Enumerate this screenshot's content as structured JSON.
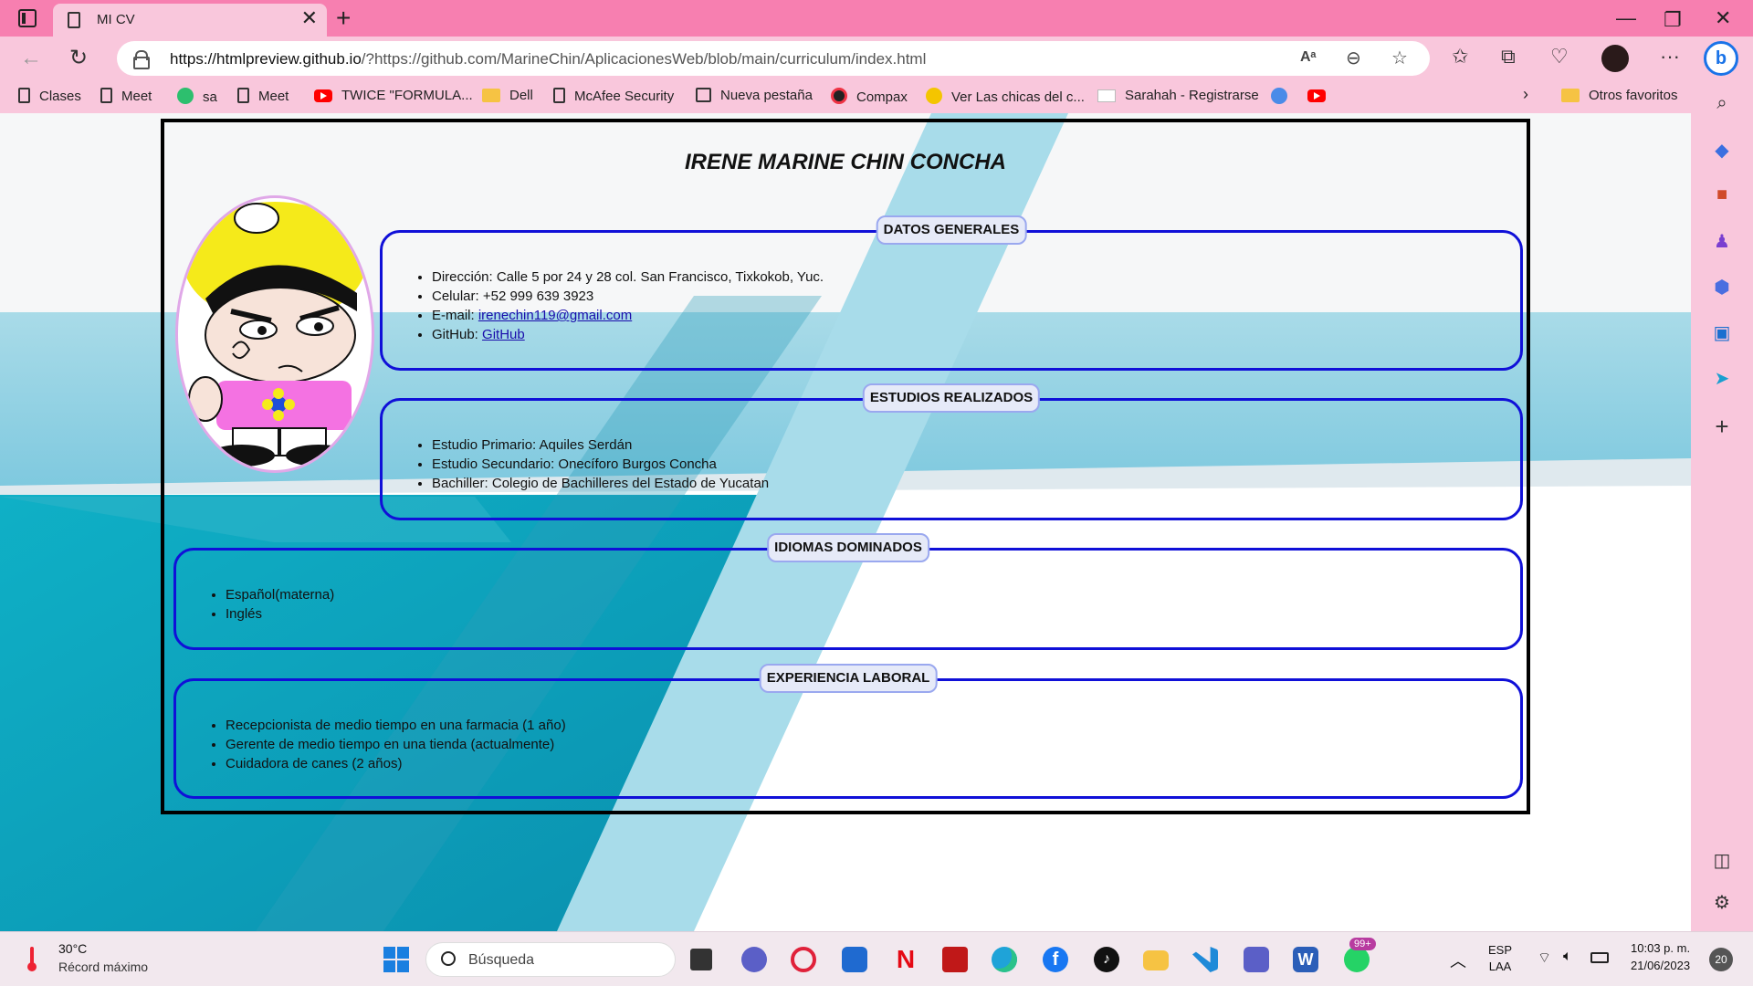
{
  "browser": {
    "tab_title": "MI CV",
    "url": "https://htmlpreview.github.io/?https://github.com/MarineChin/AplicacionesWeb/blob/main/curriculum/index.html",
    "url_host": "https://htmlpreview.github.io",
    "url_rest": "/?https://github.com/MarineChin/AplicacionesWeb/blob/main/curriculum/index.html",
    "accent": "#f77fb0",
    "bookmarks": [
      {
        "label": "Clases",
        "icon": "doc-icon"
      },
      {
        "label": "Meet",
        "icon": "doc-icon"
      },
      {
        "label": "sa",
        "icon": "badge-icon"
      },
      {
        "label": "Meet",
        "icon": "doc-icon"
      },
      {
        "label": "TWICE \"FORMULA...",
        "icon": "youtube-icon"
      },
      {
        "label": "Dell",
        "icon": "folder-icon"
      },
      {
        "label": "McAfee Security",
        "icon": "doc-icon"
      },
      {
        "label": "Nueva pestaña",
        "icon": "calendar-icon"
      },
      {
        "label": "Compax",
        "icon": "compax-icon"
      },
      {
        "label": "Ver Las chicas del c...",
        "icon": "play-icon"
      },
      {
        "label": "Sarahah - Registrarse",
        "icon": "mail-icon"
      }
    ],
    "other_favorites": "Otros favoritos"
  },
  "cv": {
    "name": "IRENE MARINE CHIN CONCHA",
    "sections": {
      "datos": {
        "title": "DATOS GENERALES",
        "items": [
          "Dirección: Calle 5 por 24 y 28 col. San Francisco, Tixkokob, Yuc.",
          "Celular: +52 999 639 3923"
        ],
        "email_label": "E-mail: ",
        "email": "irenechin119@gmail.com",
        "github_label": "GitHub: ",
        "github_link": "GitHub"
      },
      "estudios": {
        "title": "ESTUDIOS REALIZADOS",
        "items": [
          "Estudio Primario: Aquiles Serdán",
          "Estudio Secundario: Onecíforo Burgos Concha",
          "Bachiller: Colegio de Bachilleres del Estado de Yucatan"
        ]
      },
      "idiomas": {
        "title": "IDIOMAS DOMINADOS",
        "items": [
          "Español(materna)",
          "Inglés"
        ]
      },
      "experiencia": {
        "title": "EXPERIENCIA LABORAL",
        "items": [
          "Recepcionista de medio tiempo en una farmacia (1 año)",
          "Gerente de medio tiempo en una tienda (actualmente)",
          "Cuidadora de canes (2 años)"
        ]
      }
    },
    "border_color": "#1010d8"
  },
  "taskbar": {
    "temperature": "30°C",
    "weather_note": "Récord máximo",
    "search_placeholder": "Búsqueda",
    "lang_top": "ESP",
    "lang_bottom": "LAA",
    "time": "10:03 p. m.",
    "date": "21/06/2023",
    "whatsapp_badge": "99+",
    "notif_count": "20"
  }
}
